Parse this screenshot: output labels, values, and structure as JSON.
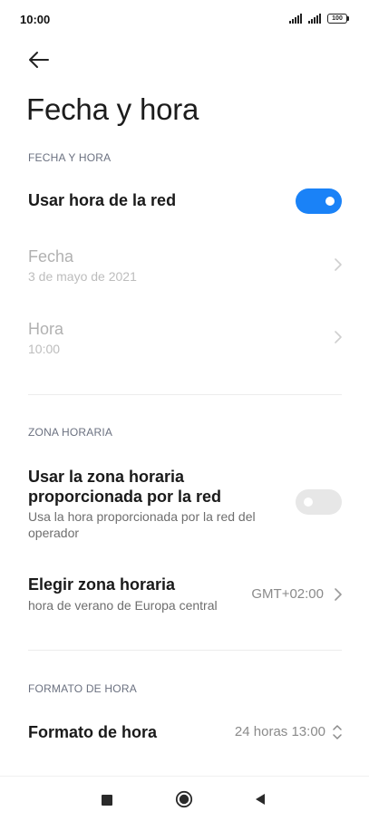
{
  "status_bar": {
    "time": "10:00",
    "battery": "100"
  },
  "header": {
    "title": "Fecha y hora"
  },
  "sections": {
    "date_time": {
      "header": "FECHA Y HORA",
      "network_time": {
        "title": "Usar hora de la red",
        "enabled": true
      },
      "date": {
        "title": "Fecha",
        "value": "3 de mayo de 2021"
      },
      "time": {
        "title": "Hora",
        "value": "10:00"
      }
    },
    "time_zone": {
      "header": "ZONA HORARIA",
      "network_zone": {
        "title": "Usar la zona horaria proporcionada por la red",
        "description": "Usa la hora proporcionada por la red del operador",
        "enabled": false
      },
      "choose_zone": {
        "title": "Elegir zona horaria",
        "description": "hora de verano de Europa central",
        "value": "GMT+02:00"
      }
    },
    "time_format": {
      "header": "FORMATO DE HORA",
      "format": {
        "title": "Formato de hora",
        "value": "24 horas 13:00"
      }
    }
  },
  "icons": {
    "back": "arrow-left-icon",
    "chevron": "chevron-right-icon",
    "spinner": "chevron-up-down-icon",
    "nav_recents": "square-icon",
    "nav_home": "circle-icon",
    "nav_back": "triangle-left-icon"
  },
  "colors": {
    "accent": "#1a82f7",
    "toggle_off": "#e7e7e7",
    "section_header": "#6b7180"
  }
}
